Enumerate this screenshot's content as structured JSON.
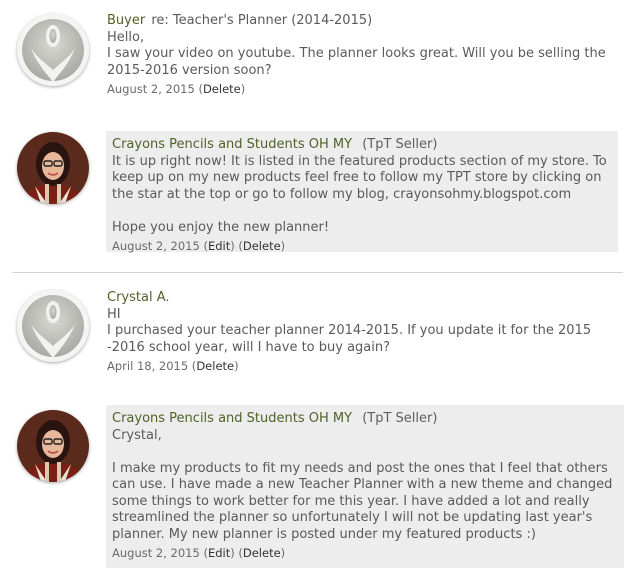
{
  "threads": [
    {
      "question": {
        "author": "Buyer",
        "subject": "re: Teacher's Planner (2014-2015)",
        "lines": [
          "Hello,",
          "I saw your video on youtube. The planner looks great. Will you be selling the",
          "2015-2016 version soon?"
        ],
        "date": "August 2, 2015",
        "delete_label": "Delete"
      },
      "reply": {
        "author": "Crayons Pencils and Students OH MY",
        "role": "(TpT Seller)",
        "lines": [
          "It is up right now! It is listed in the featured products section of my store. To",
          "keep up on my new products feel free to follow my TPT store by clicking on",
          "the star at the top or go to follow my blog, crayonsohmy.blogspot.com",
          "",
          "Hope you enjoy the new planner!"
        ],
        "date": "August 2, 2015",
        "edit_label": "Edit",
        "delete_label": "Delete"
      }
    },
    {
      "question": {
        "author": "Crystal A.",
        "lines": [
          "HI",
          "I purchased your teacher planner 2014-2015. If you update it for the 2015",
          "-2016 school year, will I have to buy again?"
        ],
        "date": "April 18, 2015",
        "delete_label": "Delete"
      },
      "reply": {
        "author": "Crayons Pencils and Students OH MY",
        "role": "(TpT Seller)",
        "lines": [
          "Crystal,",
          "",
          "I make my products to fit my needs and post the ones that I feel that others",
          "can use. I have made a new Teacher Planner with a new theme and changed",
          "some things to work better for me this year. I have added a lot and really",
          "streamlined the planner so unfortunately I will not be updating last year's",
          "planner. My new planner is posted under my featured products :)"
        ],
        "date": "August 2, 2015",
        "edit_label": "Edit",
        "delete_label": "Delete"
      }
    }
  ],
  "colors": {
    "name": "#4f6228",
    "reply_bg": "#ededed",
    "divider": "#d2d2d2"
  },
  "icons": {
    "default_avatar": "default-buyer-avatar-icon",
    "seller_avatar": "seller-avatar"
  }
}
